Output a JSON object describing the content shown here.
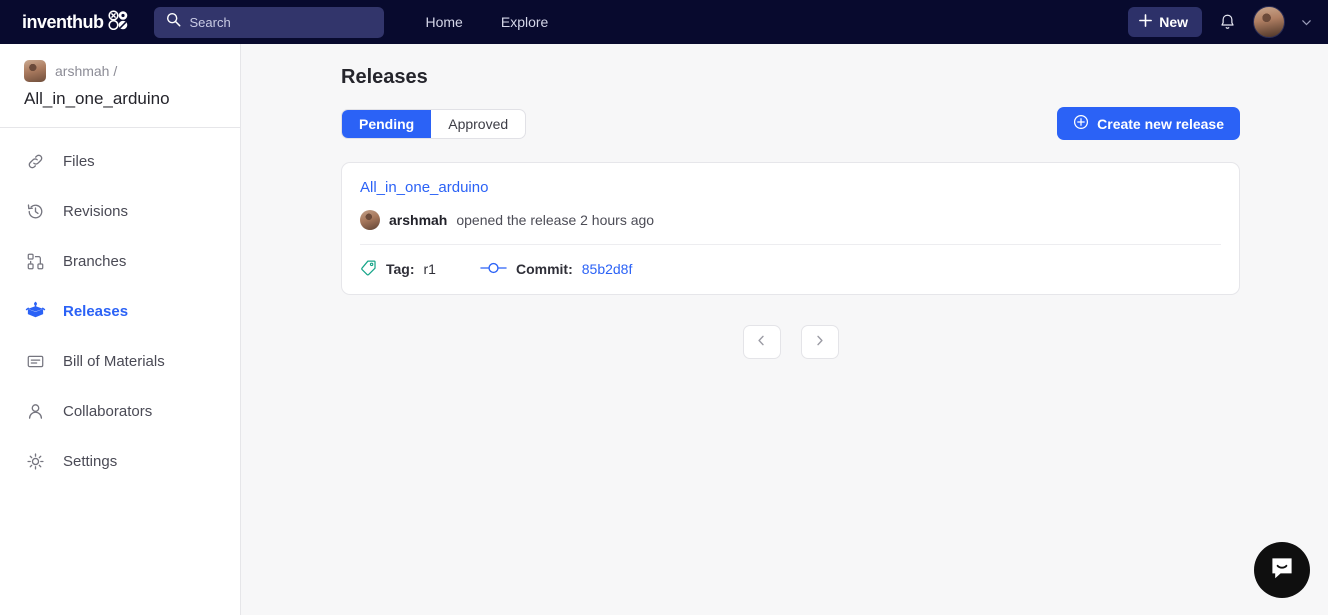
{
  "header": {
    "logo_text": "inventhub",
    "logo_icon": "inventhub-grid-logo",
    "search": {
      "placeholder": "Search",
      "icon": "search-icon"
    },
    "nav": [
      {
        "label": "Home"
      },
      {
        "label": "Explore"
      }
    ],
    "new_button": {
      "label": "New",
      "icon": "plus-icon"
    },
    "notifications_icon": "bell-icon",
    "avatar_name": "user-avatar",
    "caret_icon": "chevron-down-icon"
  },
  "sidebar": {
    "owner": "arshmah /",
    "repo": "All_in_one_arduino",
    "owner_avatar": "owner-avatar",
    "items": [
      {
        "label": "Files",
        "icon": "link-icon",
        "active": false
      },
      {
        "label": "Revisions",
        "icon": "history-icon",
        "active": false
      },
      {
        "label": "Branches",
        "icon": "branch-icon",
        "active": false
      },
      {
        "label": "Releases",
        "icon": "package-icon",
        "active": true
      },
      {
        "label": "Bill of Materials",
        "icon": "document-list-icon",
        "active": false
      },
      {
        "label": "Collaborators",
        "icon": "user-icon",
        "active": false
      },
      {
        "label": "Settings",
        "icon": "gear-icon",
        "active": false
      }
    ]
  },
  "main": {
    "title": "Releases",
    "tabs": [
      {
        "label": "Pending",
        "active": true
      },
      {
        "label": "Approved",
        "active": false
      }
    ],
    "create_button": {
      "label": "Create new release",
      "icon": "plus-circle-icon"
    },
    "release": {
      "name": "All_in_one_arduino",
      "author": "arshmah",
      "action_text": "opened the release 2 hours ago",
      "tag_label": "Tag:",
      "tag_value": "r1",
      "tag_icon": "tag-icon",
      "commit_label": "Commit:",
      "commit_value": "85b2d8f",
      "commit_icon": "commit-icon"
    },
    "pagination": {
      "prev_icon": "chevron-left-icon",
      "next_icon": "chevron-right-icon"
    }
  },
  "chat_widget": {
    "icon": "intercom-chat-icon"
  },
  "colors": {
    "header_bg": "#080a2e",
    "accent": "#2b62f6",
    "page_bg": "#f7f7f8",
    "card_bg": "#ffffff",
    "tag_icon": "#17a589",
    "commit_icon": "#2b62f6"
  }
}
